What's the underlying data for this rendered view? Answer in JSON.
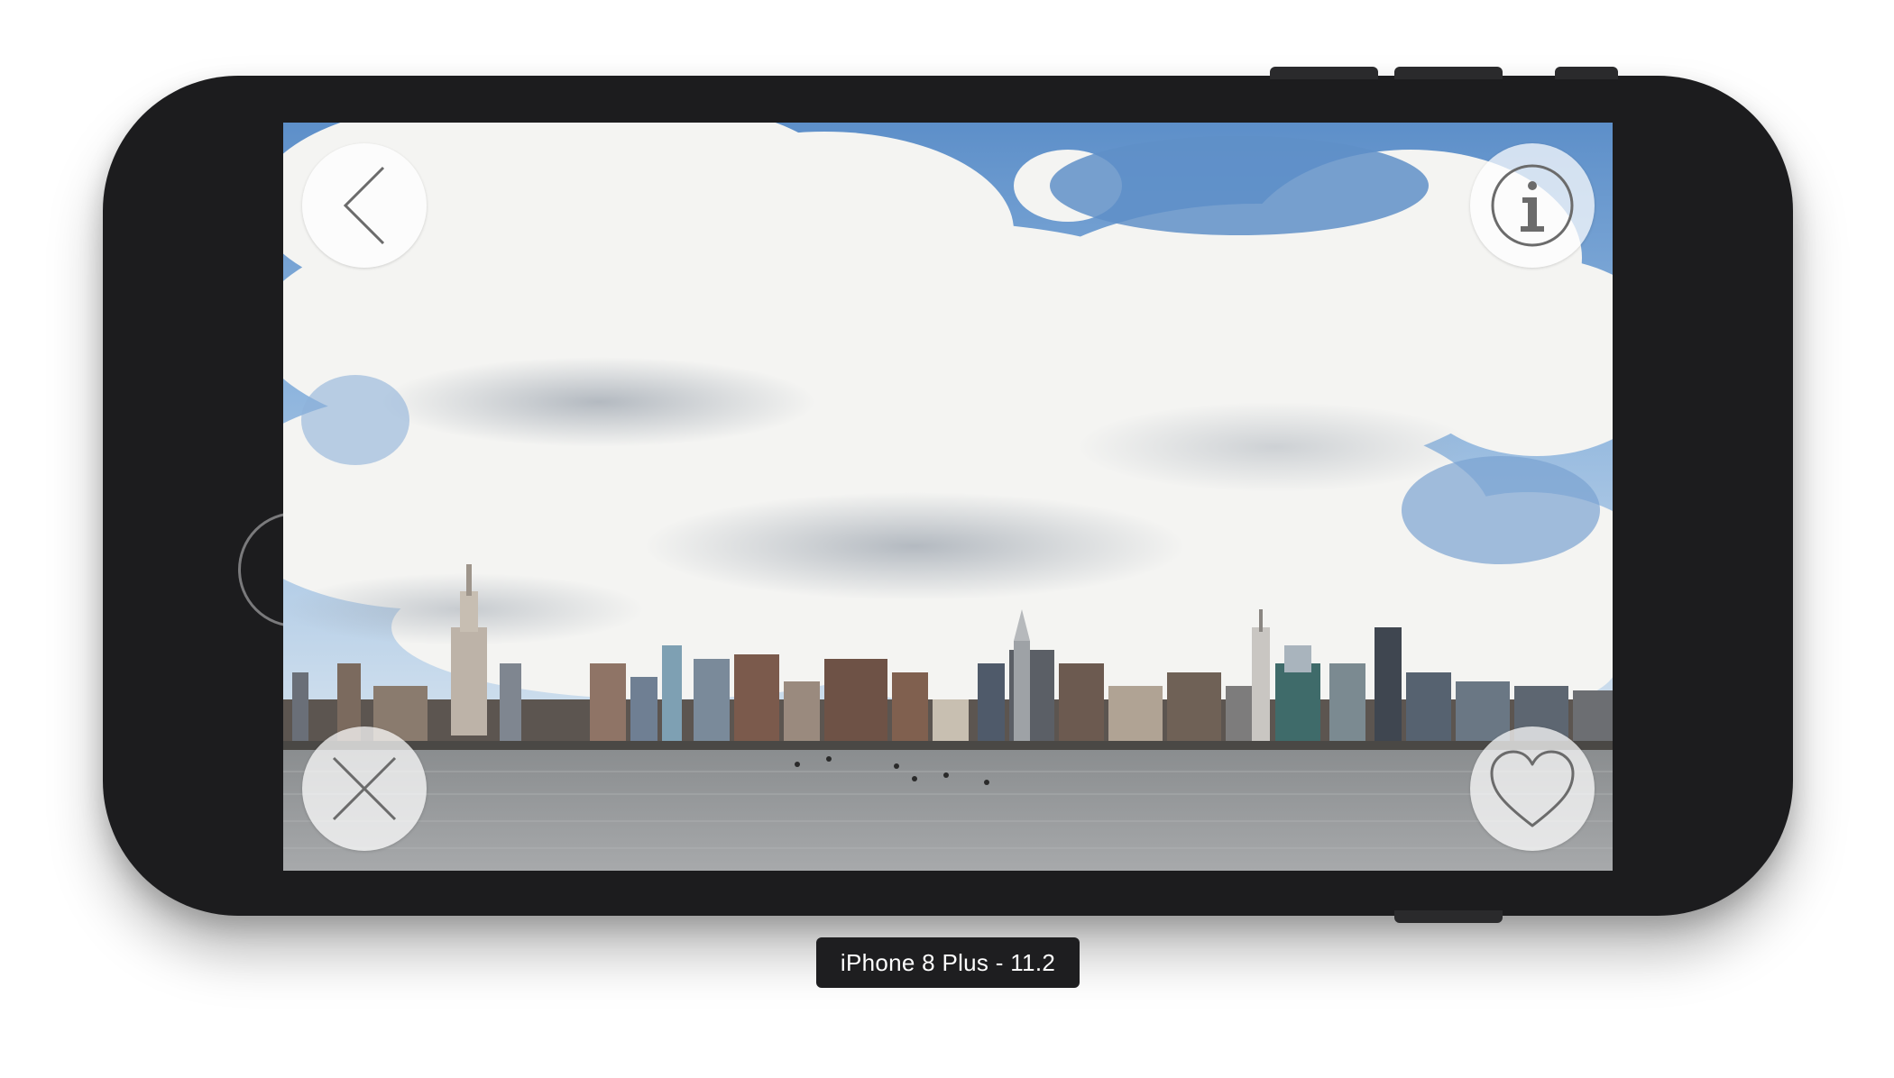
{
  "device": {
    "label": "iPhone 8 Plus - 11.2"
  },
  "screen": {
    "image_subject": "city skyline under cloudy sky",
    "buttons": {
      "back": "chevron-left-icon",
      "info": "info-icon",
      "dismiss": "close-icon",
      "like": "heart-icon"
    }
  },
  "colors": {
    "phone_body": "#1c1c1e",
    "button_bg": "#ffffff",
    "icon_stroke": "#6b6b6b",
    "label_bg": "#1e1e20"
  }
}
